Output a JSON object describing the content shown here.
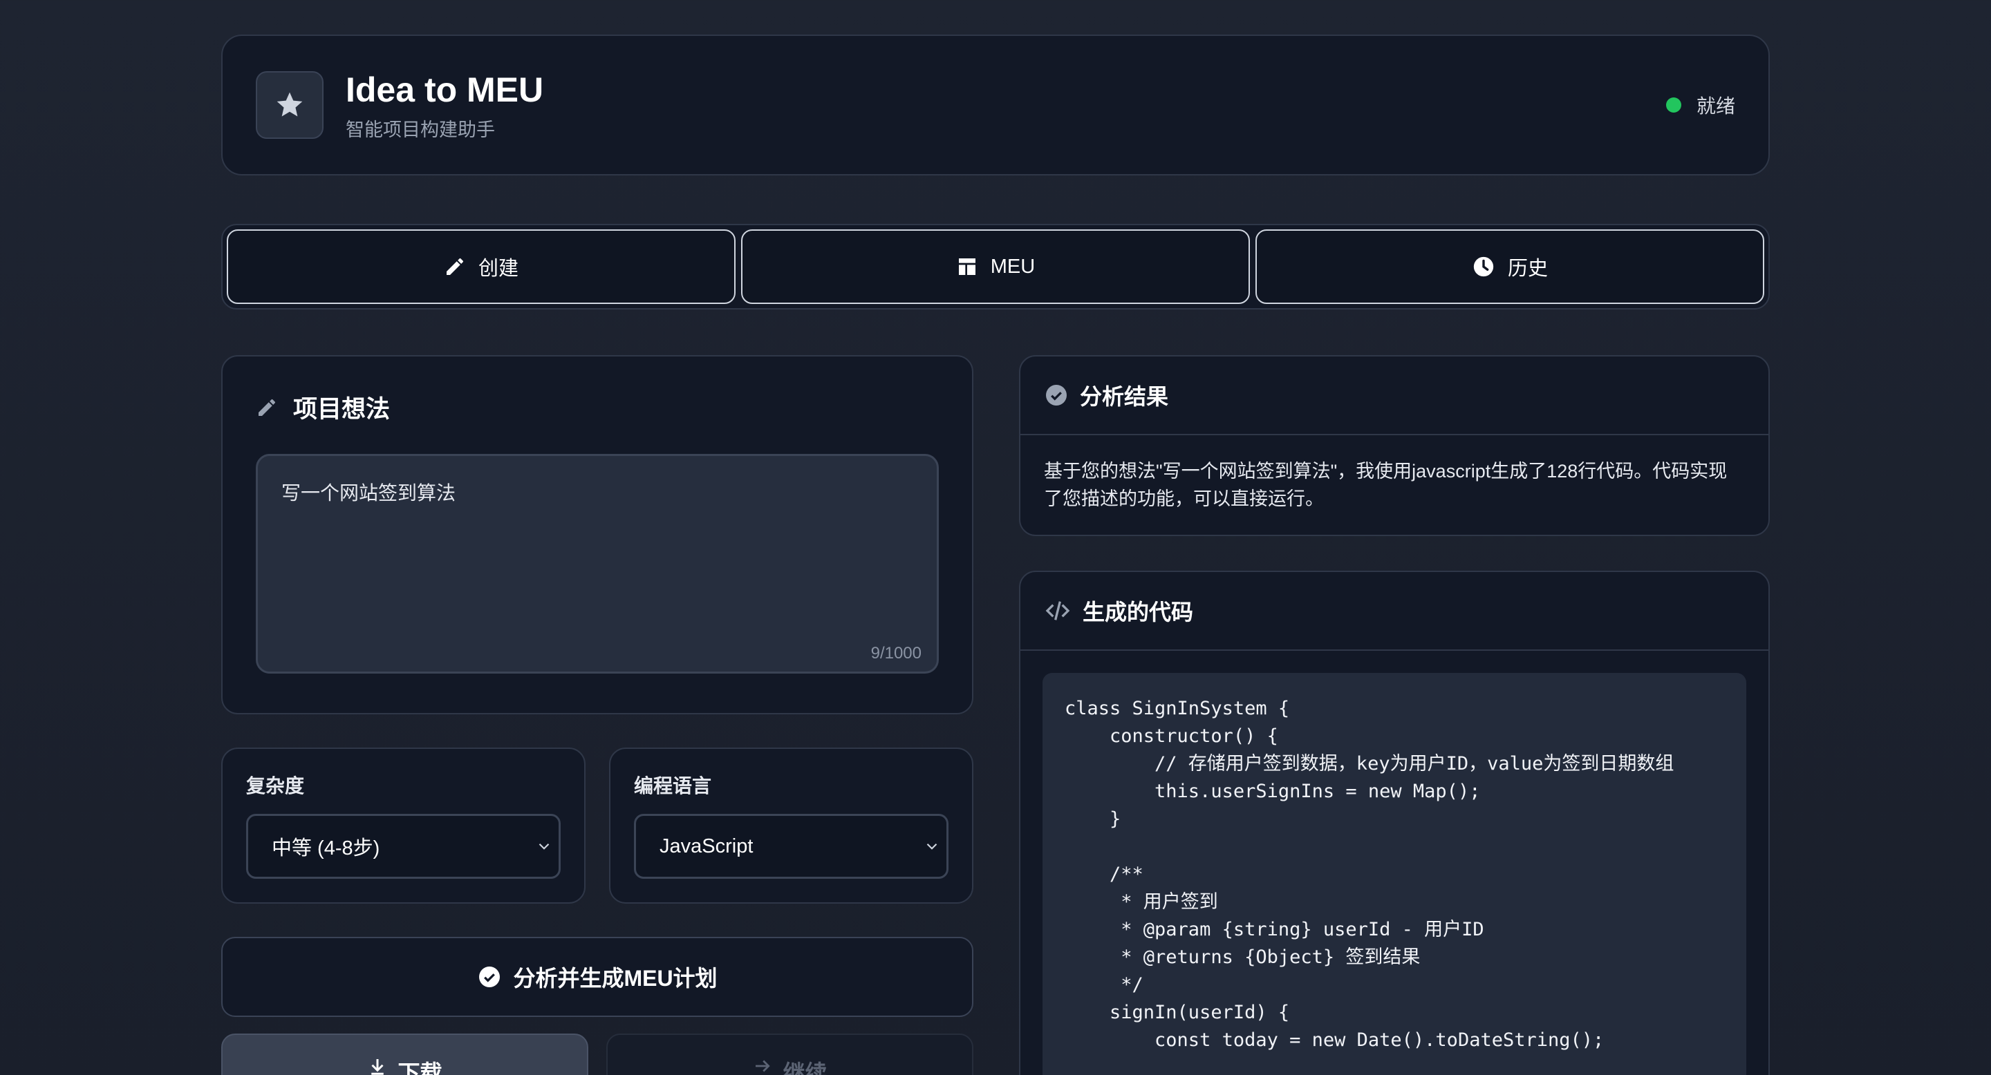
{
  "header": {
    "title": "Idea to MEU",
    "subtitle": "智能项目构建助手",
    "logo_icon": "star-icon",
    "status_text": "就绪",
    "status_color": "#22c55e"
  },
  "tabs": [
    {
      "label": "创建",
      "icon": "pencil-icon"
    },
    {
      "label": "MEU",
      "icon": "layout-icon"
    },
    {
      "label": "历史",
      "icon": "clock-icon"
    }
  ],
  "idea": {
    "heading": "项目想法",
    "text": "写一个网站签到算法",
    "counter": "9/1000"
  },
  "complexity": {
    "label": "复杂度",
    "value": "中等 (4-8步)"
  },
  "language": {
    "label": "编程语言",
    "value": "JavaScript"
  },
  "actions": {
    "analyze": "分析并生成MEU计划",
    "download": "下载",
    "continue": "继续"
  },
  "result": {
    "heading": "分析结果",
    "text": "基于您的想法\"写一个网站签到算法\"，我使用javascript生成了128行代码。代码实现了您描述的功能，可以直接运行。"
  },
  "code": {
    "heading": "生成的代码",
    "lines": [
      "class SignInSystem {",
      "    constructor() {",
      "        // 存储用户签到数据，key为用户ID，value为签到日期数组",
      "        this.userSignIns = new Map();",
      "    }",
      "",
      "    /**",
      "     * 用户签到",
      "     * @param {string} userId - 用户ID",
      "     * @returns {Object} 签到结果",
      "     */",
      "    signIn(userId) {",
      "        const today = new Date().toDateString();"
    ]
  },
  "colors": {
    "accent_green": "#22c55e",
    "background": "#1e2431",
    "card": "#121826"
  }
}
